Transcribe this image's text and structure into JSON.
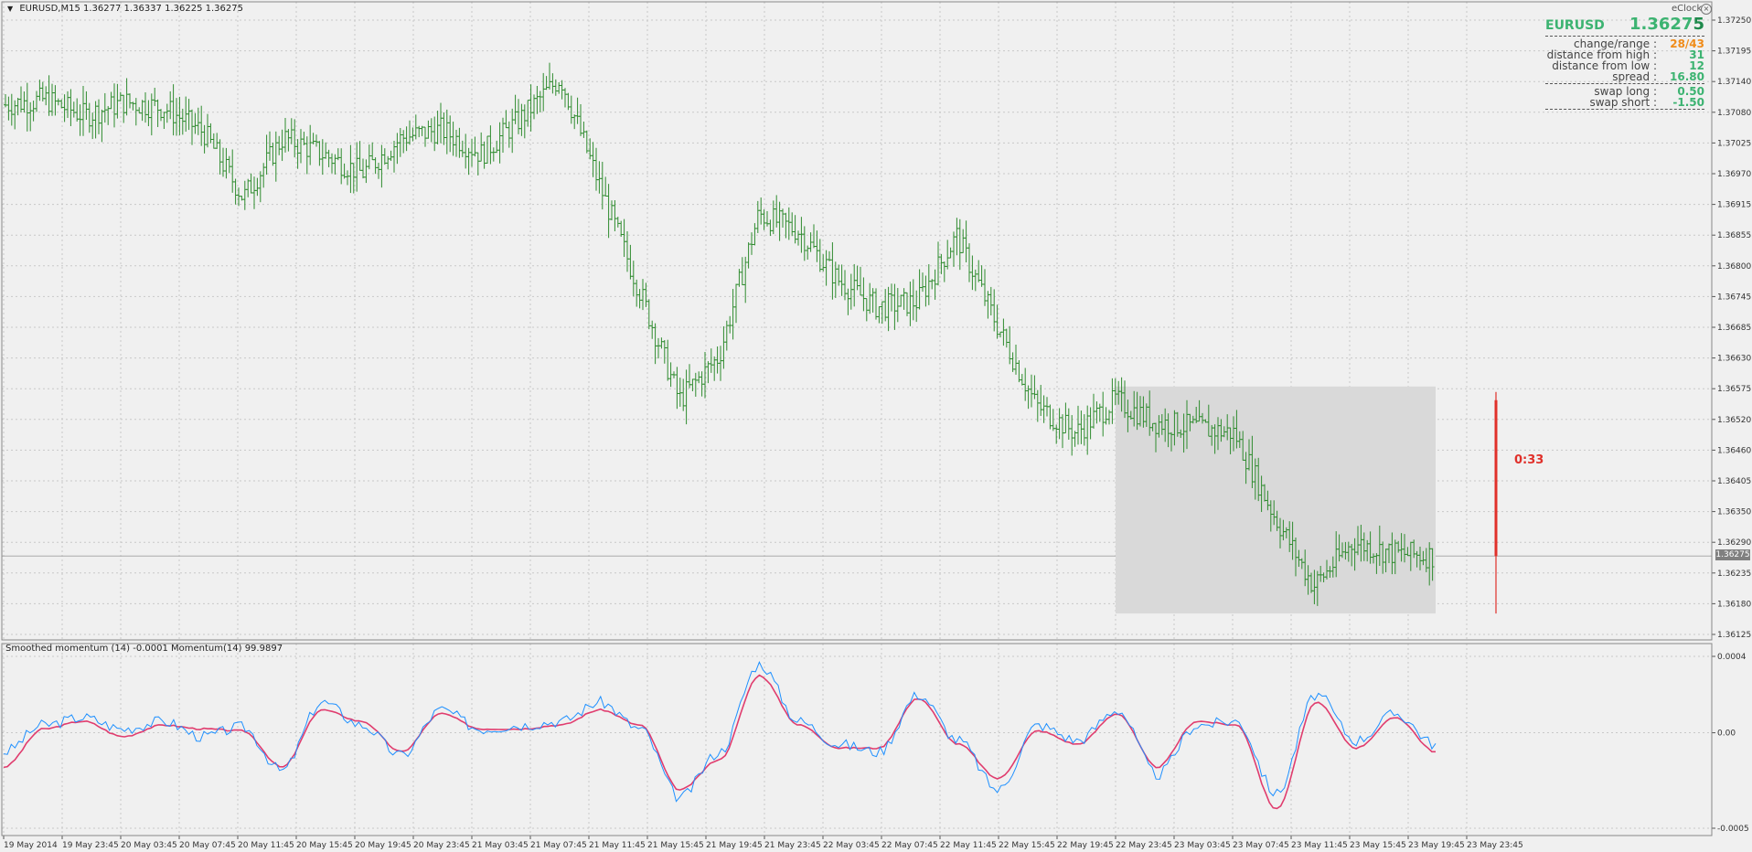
{
  "header": {
    "symbol_timeframe": "EURUSD,M15",
    "ohlc": "1.36277 1.36337 1.36225 1.36275"
  },
  "indicator_header": {
    "title": "Smoothed momentum (14) -0.0001  Momentum(14) 99.9897"
  },
  "price_axis": {
    "labels": [
      "1.37250",
      "1.37195",
      "1.37140",
      "1.37080",
      "1.37025",
      "1.36970",
      "1.36915",
      "1.36855",
      "1.36800",
      "1.36745",
      "1.36685",
      "1.36630",
      "1.36575",
      "1.36520",
      "1.36460",
      "1.36405",
      "1.36350",
      "1.36290",
      "1.36235",
      "1.36180",
      "1.36125"
    ],
    "current_price_tag": "1.36275"
  },
  "indicator_axis": {
    "labels": [
      "0.0004",
      "0.00",
      "-0.0005"
    ]
  },
  "time_axis": {
    "labels": [
      "19 May 2014",
      "19 May 23:45",
      "20 May 03:45",
      "20 May 07:45",
      "20 May 11:45",
      "20 May 15:45",
      "20 May 19:45",
      "20 May 23:45",
      "21 May 03:45",
      "21 May 07:45",
      "21 May 11:45",
      "21 May 15:45",
      "21 May 19:45",
      "21 May 23:45",
      "22 May 03:45",
      "22 May 07:45",
      "22 May 11:45",
      "22 May 15:45",
      "22 May 19:45",
      "22 May 23:45",
      "23 May 03:45",
      "23 May 07:45",
      "23 May 11:45",
      "23 May 15:45",
      "23 May 19:45",
      "23 May 23:45"
    ]
  },
  "candle_timer": "0:33",
  "clock_widget": {
    "label": "eClock"
  },
  "info_panel": {
    "symbol": "EURUSD",
    "price_main": "1.3627",
    "price_last_digit": "5",
    "rows": [
      {
        "label": "change/range :",
        "value": "28/43",
        "color": "#f08c1a"
      },
      {
        "label": "distance from high :",
        "value": "31",
        "color": "#3cb371"
      },
      {
        "label": "distance from low :",
        "value": "12",
        "color": "#3cb371"
      },
      {
        "label": "spread :",
        "value": "16.80",
        "color": "#3cb371"
      }
    ],
    "swap_rows": [
      {
        "label": "swap long :",
        "value": "0.50",
        "color": "#3cb371"
      },
      {
        "label": "swap short :",
        "value": "-1.50",
        "color": "#3cb371"
      }
    ]
  },
  "colors": {
    "bars": "#2e8b2e",
    "momentum": "#1e90ff",
    "smoothed_momentum": "#e03c6e",
    "session_box": "#d9d9d9",
    "timer": "#e0302a"
  },
  "chart_data": [
    {
      "type": "ohlc",
      "instrument": "EURUSD",
      "timeframe": "M15",
      "ylim": [
        1.36125,
        1.37275
      ],
      "x": [
        "19 May 2014",
        "19 May 23:45",
        "20 May 03:45",
        "20 May 07:45",
        "20 May 11:45",
        "20 May 15:45",
        "20 May 19:45",
        "20 May 23:45",
        "21 May 03:45",
        "21 May 07:45",
        "21 May 11:45",
        "21 May 15:45",
        "21 May 19:45",
        "21 May 23:45",
        "22 May 03:45",
        "22 May 07:45",
        "22 May 11:45",
        "22 May 15:45",
        "22 May 19:45",
        "22 May 23:45",
        "23 May 03:45",
        "23 May 07:45",
        "23 May 11:45",
        "23 May 15:45",
        "23 May 19:45",
        "23 May 23:45"
      ],
      "close_path": [
        1.371,
        1.3711,
        1.3708,
        1.37105,
        1.37095,
        1.3705,
        1.3693,
        1.3704,
        1.3701,
        1.36975,
        1.3704,
        1.37055,
        1.3701,
        1.37075,
        1.3715,
        1.3695,
        1.3676,
        1.3656,
        1.3664,
        1.369,
        1.3687,
        1.3678,
        1.3673,
        1.3674,
        1.3686,
        1.367,
        1.3655,
        1.365,
        1.3656,
        1.3652,
        1.3651,
        1.365,
        1.3635,
        1.3622,
        1.363,
        1.3628,
        1.36275
      ],
      "session_box": {
        "from": "22 May 23:45",
        "to": "23 May 23:45",
        "high": 1.36585,
        "low": 1.3617
      },
      "last_price": 1.36275
    },
    {
      "type": "line",
      "title": "Smoothed momentum (14) -0.0001  Momentum(14) 99.9897",
      "ylim": [
        -0.0005,
        0.0004
      ],
      "series": [
        {
          "name": "Smoothed momentum (14)",
          "values": [
            -0.00018,
            2e-05,
            6e-05,
            -2e-05,
            4e-05,
            2e-05,
            1e-05,
            -0.00018,
            0.00012,
            6e-05,
            -0.0001,
            0.0001,
            2e-05,
            2e-05,
            4e-05,
            0.00012,
            4e-05,
            -0.0003,
            -0.00014,
            0.0003,
            4e-05,
            -8e-05,
            -8e-05,
            0.00018,
            -6e-05,
            -0.00024,
            1e-05,
            -6e-05,
            0.0001,
            -0.00018,
            6e-05,
            4e-05,
            -0.0004,
            0.00016,
            -8e-05,
            8e-05,
            -0.0001
          ]
        },
        {
          "name": "Momentum(14)",
          "values": [
            -0.0001,
            4e-05,
            8e-05,
            2e-05,
            6e-05,
            -2e-05,
            3e-05,
            -0.0002,
            0.00016,
            4e-05,
            -0.00012,
            0.00012,
            2e-05,
            4e-05,
            6e-05,
            0.00016,
            2e-05,
            -0.00034,
            -0.0001,
            0.00036,
            6e-05,
            -6e-05,
            -0.0001,
            0.0002,
            -4e-05,
            -0.0003,
            4e-05,
            -4e-05,
            0.00012,
            -0.00022,
            4e-05,
            6e-05,
            -0.00032,
            0.0002,
            -4e-05,
            0.0001,
            -6e-05
          ]
        }
      ]
    }
  ]
}
